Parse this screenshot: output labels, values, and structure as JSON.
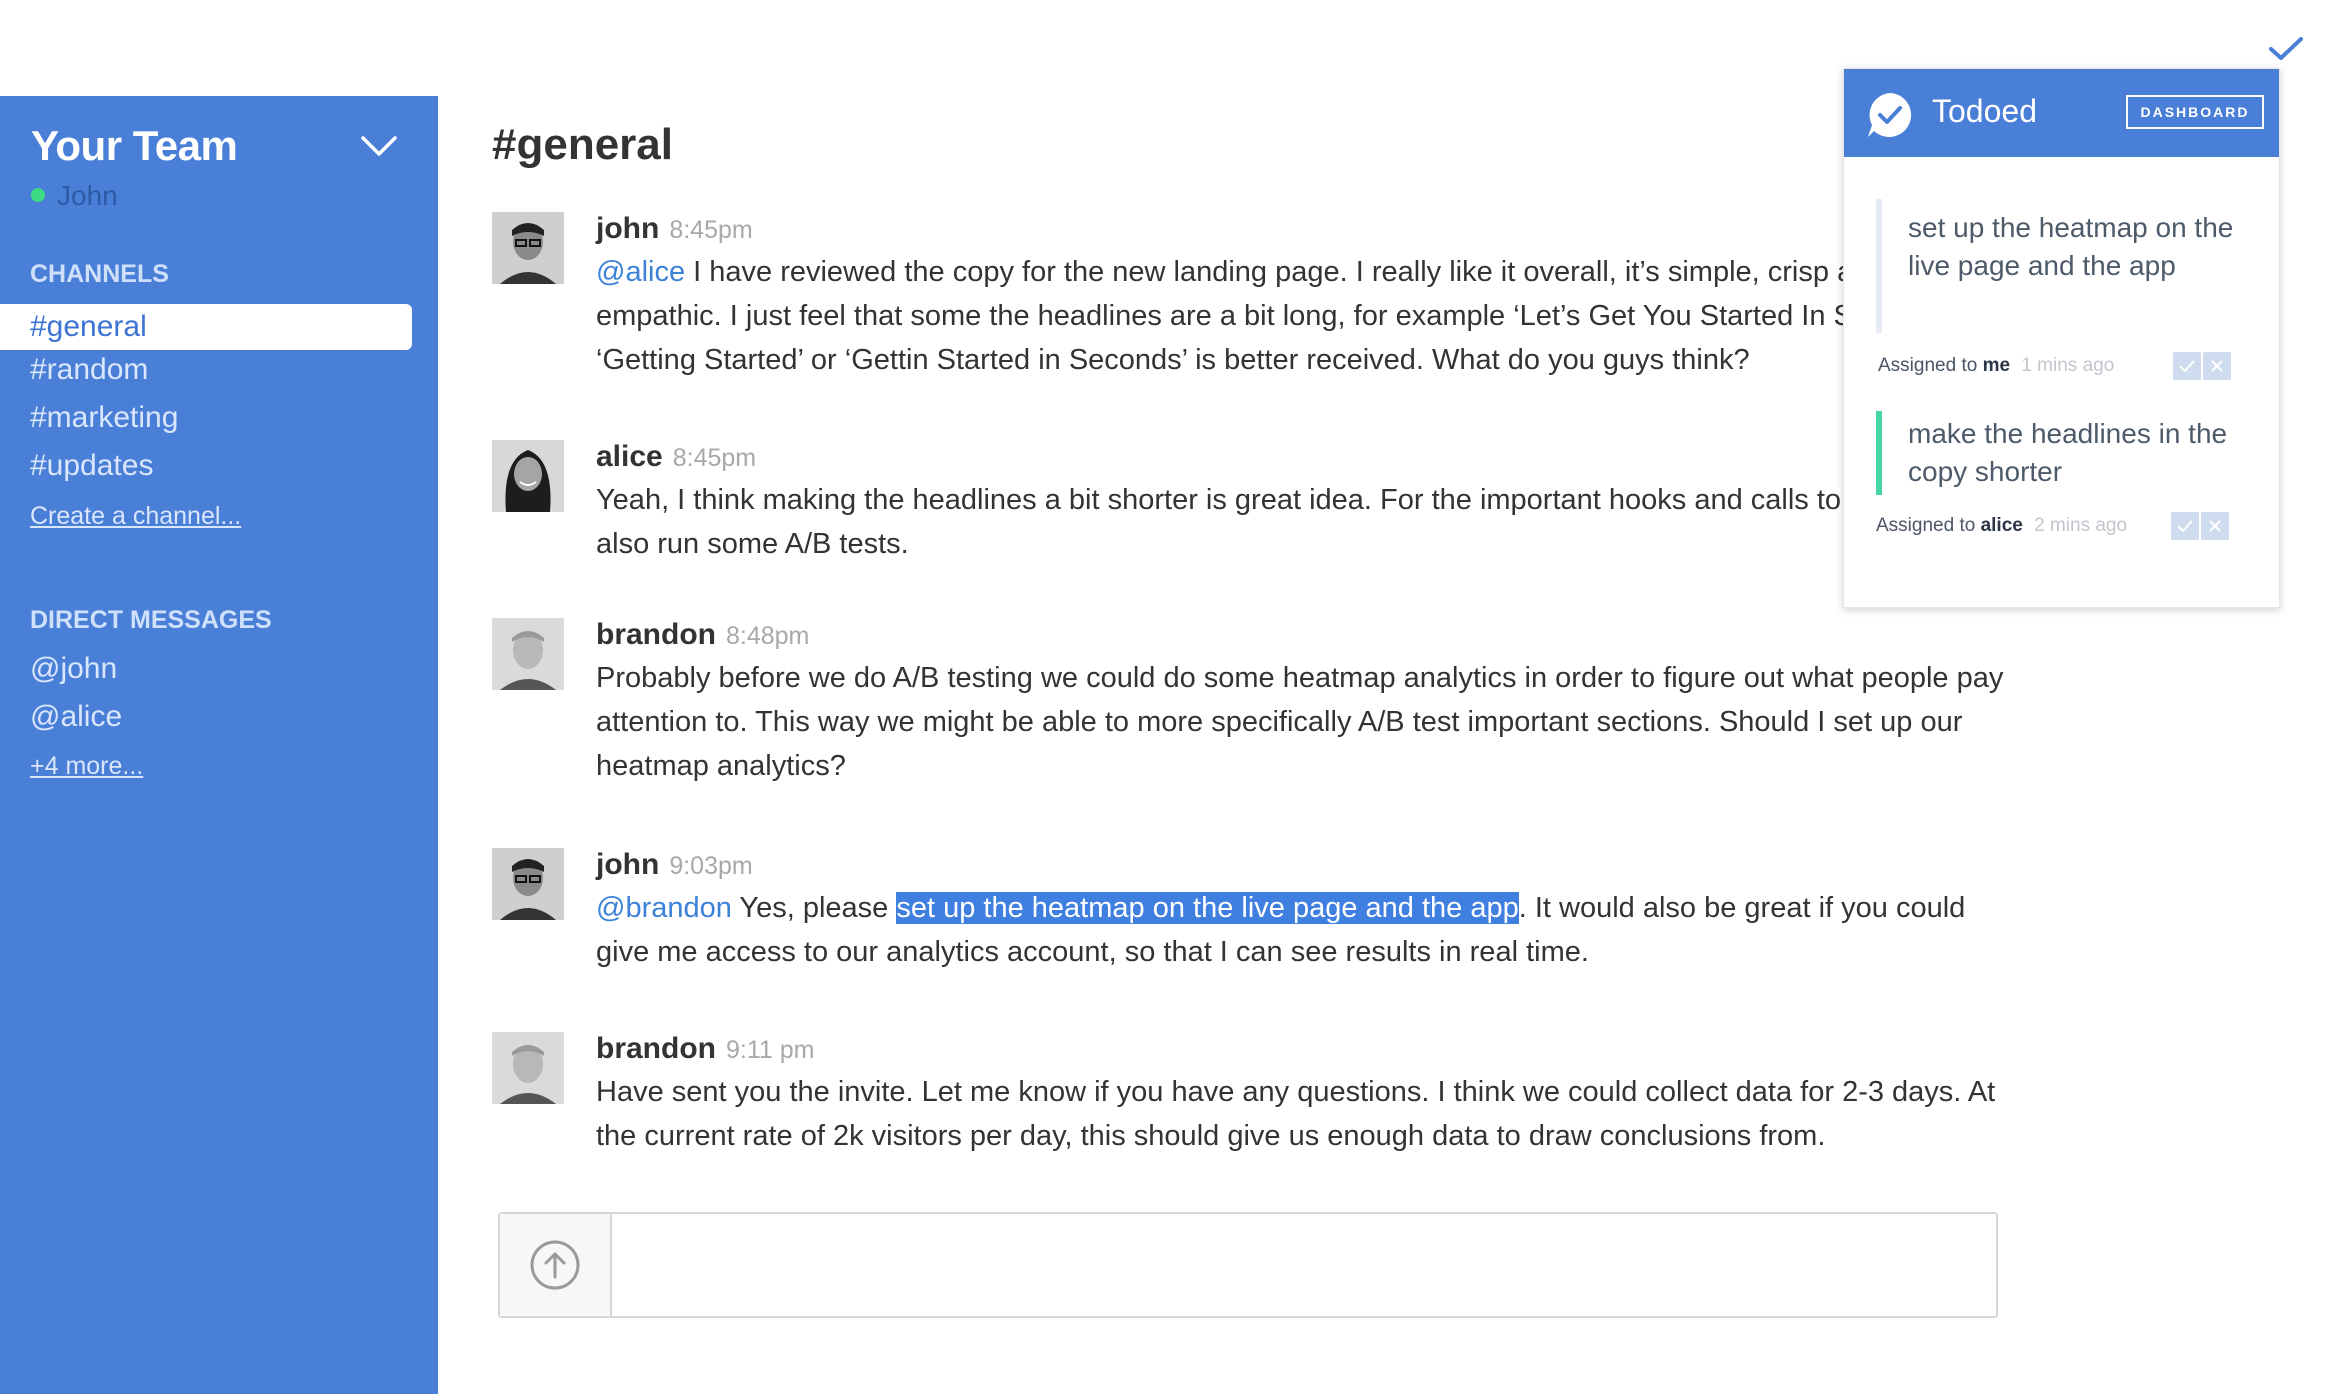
{
  "sidebar": {
    "team_name": "Your Team",
    "user_name": "John",
    "channels_label": "CHANNELS",
    "channels": [
      "#general",
      "#random",
      "#marketing",
      "#updates"
    ],
    "create_channel": "Create a channel...",
    "dm_label": "DIRECT MESSAGES",
    "dms": [
      "@john",
      "@alice"
    ],
    "more_dms": "+4 more..."
  },
  "main": {
    "channel_title": "#general",
    "messages": [
      {
        "author": "john",
        "time": "8:45pm",
        "mention": "@alice",
        "text": " I have reviewed the copy for the new landing page. I really like it overall, it’s simple, crisp and empathic. I just feel that some the headlines are a bit long, for example ‘Let’s Get You Started In Sec Perhaps ‘Getting Started’ or ‘Gettin Started in Seconds’ is better received. What do you guys think?"
      },
      {
        "author": "alice",
        "time": "8:45pm",
        "text": "Yeah, I think making the headlines a bit shorter is great idea. For the important hooks and calls to ac could also run some A/B tests."
      },
      {
        "author": "brandon",
        "time": "8:48pm",
        "text": "Probably before we do A/B testing we could do some heatmap analytics in order to figure out what people pay attention to. This way we might be able to more specifically A/B test important sections. Should I set up our heatmap analytics?"
      },
      {
        "author": "john",
        "time": "9:03pm",
        "mention": "@brandon",
        "text_before": " Yes, please ",
        "highlight": "set up the heatmap on the live page and the app",
        "text_after": ". It would also be great if you could give me access to our analytics account, so that I can see results in real time."
      },
      {
        "author": "brandon",
        "time": "9:11 pm",
        "text": "Have sent you the invite. Let me know if you have any questions. I think we could collect data for 2-3 days. At the current rate of 2k visitors per day, this should give us enough data to draw conclusions from."
      }
    ],
    "composer": {
      "placeholder": "",
      "upload_icon": "upload-icon"
    }
  },
  "todoed": {
    "title": "Todoed",
    "dashboard_label": "DASHBOARD",
    "tasks": [
      {
        "text": "set up the heatmap on the live page and the app",
        "assigned_prefix": "Assigned to",
        "assignee": "me",
        "ago": "1 mins ago"
      },
      {
        "text": "make the headlines in the copy shorter",
        "assigned_prefix": "Assigned to",
        "assignee": "alice",
        "ago": "2 mins ago"
      }
    ]
  },
  "colors": {
    "sidebar_bg": "#4a7fd8",
    "accent": "#3b82d8",
    "highlight_bg": "#3f7fe0",
    "status_online": "#3ddc84",
    "task_active_bar": "#45d6a8"
  }
}
